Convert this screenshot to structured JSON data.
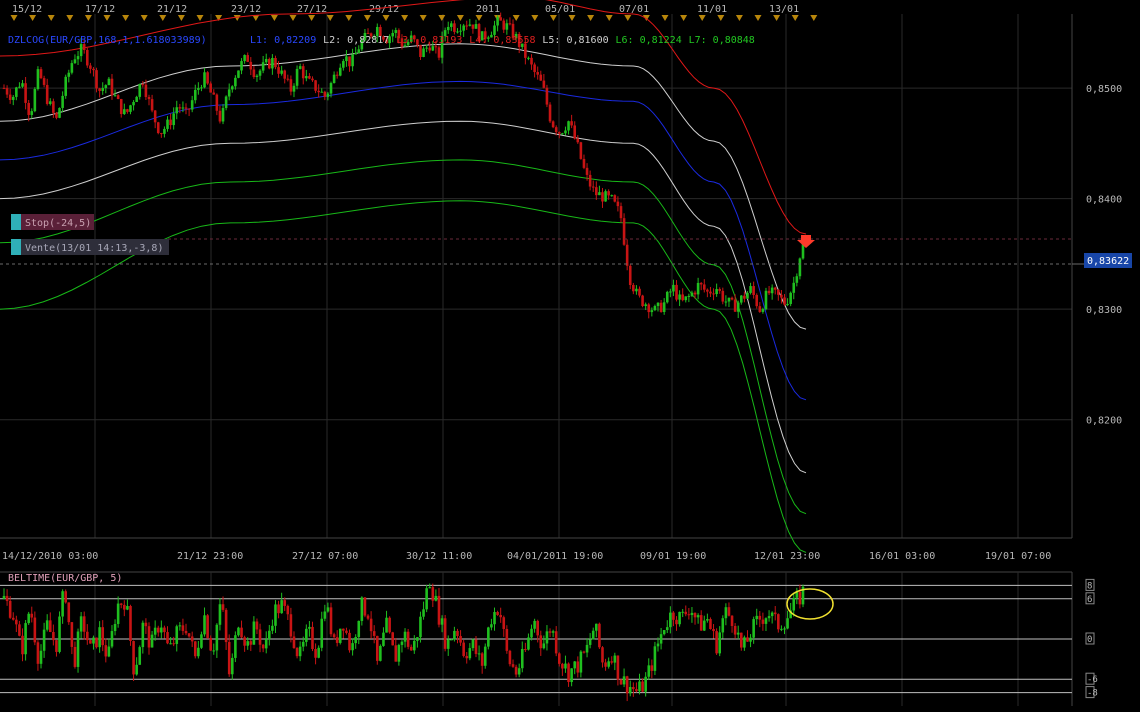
{
  "colors": {
    "background": "#000000",
    "grid": "#2a2a2a",
    "axis_text": "#b8b8b8",
    "bull": "#1fbf1f",
    "bear": "#c81414",
    "band_red": "#e01818",
    "band_white": "#cfcfcf",
    "band_blue": "#1a2ae0",
    "band_green": "#18b818",
    "stop_label_bg": "#5a2038",
    "order_label_bg": "#2e2e3a",
    "tag_teal": "#2fb0b8",
    "price_tag_bg": "#1846a8",
    "highlight_ellipse": "#f0e030",
    "signal_arrow": "#ff3a2a"
  },
  "top_date_labels": [
    "15/12",
    "17/12",
    "21/12",
    "23/12",
    "27/12",
    "29/12",
    "2011",
    "05/01",
    "07/01",
    "11/01",
    "13/01"
  ],
  "bottom_date_labels": [
    "14/12/2010 03:00",
    "21/12 23:00",
    "27/12 07:00",
    "30/12 11:00",
    "04/01/2011 19:00",
    "09/01 19:00",
    "12/01 23:00",
    "16/01 03:00",
    "19/01 07:00"
  ],
  "indicator_header": {
    "name": "DZLCOG(EUR/GBP,168,1,1.618033989)",
    "lines": [
      {
        "text": "L1: 0,82209",
        "color": "#2a48ff"
      },
      {
        "text": "L2: 0,82817",
        "color": "#d0d0d0"
      },
      {
        "text": "L3: 0,83193",
        "color": "#e02020"
      },
      {
        "text": "L4: 0,83558",
        "color": "#e02020"
      },
      {
        "text": "L5: 0,81600",
        "color": "#d0d0d0"
      },
      {
        "text": "L6: 0,81224",
        "color": "#22c822"
      },
      {
        "text": "L7: 0,80848",
        "color": "#22c822"
      }
    ]
  },
  "order_labels": {
    "stop": "Stop(-24,5)",
    "order": "Vente(13/01 14:13,-3,8)"
  },
  "current_price_tag": "0,83622",
  "oscillator_title": "BELTIME(EUR/GBP, 5)",
  "oscillator_levels": [
    "8",
    "6",
    "0",
    "-6",
    "-8"
  ],
  "chart_data": [
    {
      "type": "candlestick",
      "title": "",
      "y_tick_labels": [
        "0,8500",
        "0,8400",
        "0,8300",
        "0,8200"
      ],
      "y_ticks": [
        0.85,
        0.84,
        0.83,
        0.82
      ],
      "ylim": [
        0.8093,
        0.8567
      ],
      "grid": true,
      "current_price": 0.83622,
      "price_path": [
        0.85,
        0.8492,
        0.8508,
        0.8475,
        0.8515,
        0.849,
        0.847,
        0.8502,
        0.8528,
        0.8535,
        0.852,
        0.8498,
        0.8505,
        0.8488,
        0.8475,
        0.8492,
        0.8508,
        0.8478,
        0.846,
        0.8468,
        0.8485,
        0.8475,
        0.8495,
        0.851,
        0.8492,
        0.847,
        0.8502,
        0.8518,
        0.8528,
        0.8512,
        0.852,
        0.8525,
        0.8512,
        0.8498,
        0.852,
        0.8505,
        0.85,
        0.8492,
        0.851,
        0.853,
        0.8522,
        0.854,
        0.8548,
        0.8555,
        0.8545,
        0.8552,
        0.8538,
        0.8545,
        0.853,
        0.854,
        0.8528,
        0.856,
        0.8555,
        0.856,
        0.8558,
        0.8545,
        0.8552,
        0.856,
        0.8555,
        0.8545,
        0.853,
        0.8515,
        0.8502,
        0.847,
        0.846,
        0.847,
        0.8448,
        0.842,
        0.8405,
        0.8402,
        0.8398,
        0.8385,
        0.833,
        0.831,
        0.8305,
        0.8298,
        0.8305,
        0.832,
        0.8305,
        0.8312,
        0.8322,
        0.8315,
        0.832,
        0.8308,
        0.8302,
        0.831,
        0.8318,
        0.83,
        0.8315,
        0.8312,
        0.8305,
        0.8325,
        0.8362
      ],
      "bands": [
        {
          "name": "L4",
          "color": "band_red",
          "x": [
            0,
            0.25,
            0.45,
            0.55,
            0.62,
            0.7
          ],
          "y": [
            0.8529,
            0.8567,
            0.8582,
            0.8567,
            0.85,
            0.8368
          ]
        },
        {
          "name": "L3",
          "color": "band_white",
          "x": [
            0,
            0.2,
            0.4,
            0.55,
            0.62,
            0.7
          ],
          "y": [
            0.847,
            0.852,
            0.854,
            0.852,
            0.8452,
            0.8282
          ]
        },
        {
          "name": "L1",
          "color": "band_blue",
          "x": [
            0,
            0.2,
            0.4,
            0.55,
            0.62,
            0.7
          ],
          "y": [
            0.8435,
            0.8485,
            0.8506,
            0.8488,
            0.8415,
            0.8218
          ]
        },
        {
          "name": "L2",
          "color": "band_white",
          "x": [
            0,
            0.2,
            0.4,
            0.55,
            0.62,
            0.7
          ],
          "y": [
            0.84,
            0.845,
            0.847,
            0.845,
            0.8375,
            0.8152
          ]
        },
        {
          "name": "L5",
          "color": "band_green",
          "x": [
            0,
            0.2,
            0.4,
            0.55,
            0.62,
            0.7
          ],
          "y": [
            0.836,
            0.8415,
            0.8435,
            0.8415,
            0.834,
            0.8115
          ]
        },
        {
          "name": "L6",
          "color": "band_green",
          "x": [
            0,
            0.2,
            0.4,
            0.55,
            0.62,
            0.7
          ],
          "y": [
            0.83,
            0.8378,
            0.8398,
            0.8378,
            0.83,
            0.808
          ]
        }
      ]
    },
    {
      "type": "bar",
      "title": "BELTIME(EUR/GBP, 5)",
      "ylim": [
        -10,
        10
      ],
      "levels": [
        8,
        6,
        0,
        -6,
        -8
      ],
      "values": [
        6,
        4,
        -2,
        5,
        -3,
        2,
        -1,
        8,
        -4,
        3,
        -2,
        1,
        -3,
        5,
        6,
        -5,
        2,
        -1,
        3,
        -2,
        1,
        2,
        -3,
        4,
        -2,
        6,
        -6,
        3,
        -1,
        2,
        -2,
        4,
        5,
        2,
        -3,
        1,
        -2,
        6,
        -1,
        3,
        -2,
        5,
        4,
        -4,
        2,
        -3,
        1,
        -2,
        3,
        9,
        4,
        -1,
        2,
        -2,
        -1,
        -4,
        3,
        5,
        -3,
        -5,
        -2,
        3,
        -1,
        2,
        -3,
        -5,
        -4,
        -2,
        2,
        -4,
        -2,
        -6,
        -7,
        -8,
        -6,
        -2,
        2,
        4,
        3,
        5,
        2,
        3,
        -1,
        4,
        3,
        -2,
        1,
        3,
        4,
        2,
        3,
        5,
        7
      ]
    }
  ]
}
